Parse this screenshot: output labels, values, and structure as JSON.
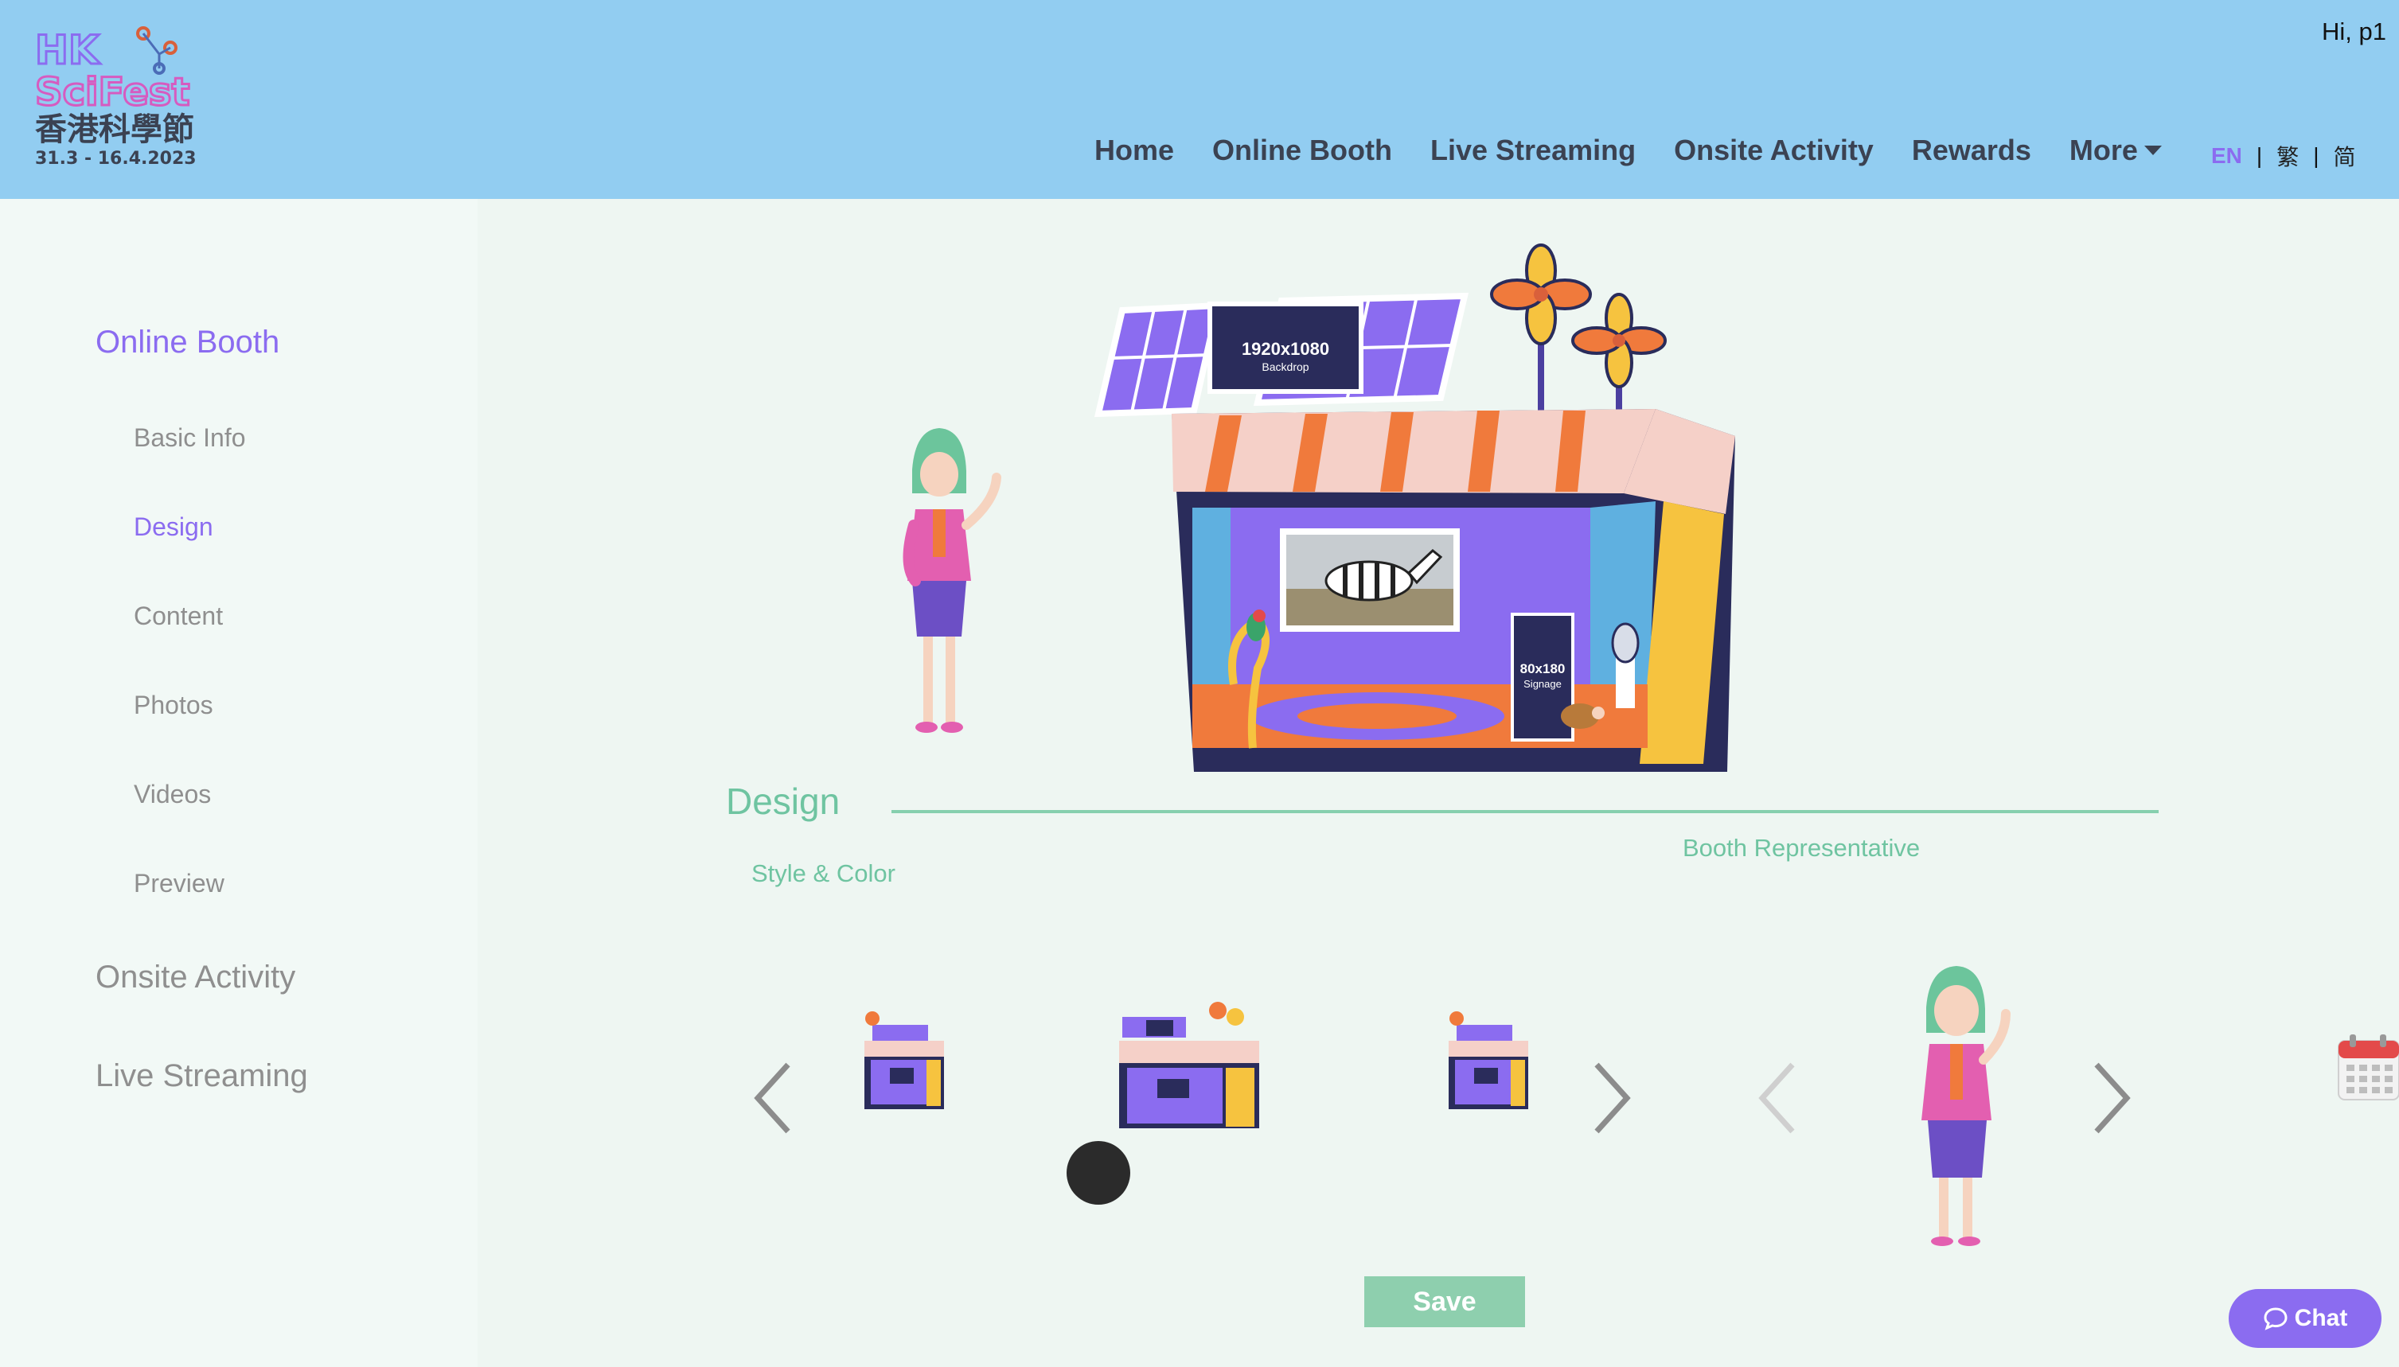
{
  "header": {
    "logo": {
      "line1": "HK",
      "line2": "SciFest",
      "chinese": "香港科學節",
      "dates": "31.3 - 16.4.2023"
    },
    "greeting": "Hi, p1",
    "nav": [
      "Home",
      "Online Booth",
      "Live Streaming",
      "Onsite Activity",
      "Rewards"
    ],
    "more_label": "More",
    "languages": {
      "en": "EN",
      "tc": "繁",
      "sc": "简",
      "separator": "|"
    }
  },
  "sidebar": {
    "online_booth": "Online Booth",
    "items": [
      "Basic Info",
      "Design",
      "Content",
      "Photos",
      "Videos",
      "Preview"
    ],
    "onsite_activity": "Onsite Activity",
    "live_streaming": "Live Streaming"
  },
  "booth_preview": {
    "backdrop_size": "1920x1080",
    "backdrop_label": "Backdrop",
    "signage_size": "80x180",
    "signage_label": "Signage"
  },
  "design": {
    "title": "Design",
    "style_color_label": "Style & Color",
    "representative_label": "Booth Representative"
  },
  "buttons": {
    "save": "Save",
    "chat": "Chat"
  },
  "colors": {
    "header_bg": "#92cdf1",
    "accent_purple": "#8b6cf0",
    "accent_green": "#6fc4a1",
    "save_bg": "#8ecfae"
  }
}
